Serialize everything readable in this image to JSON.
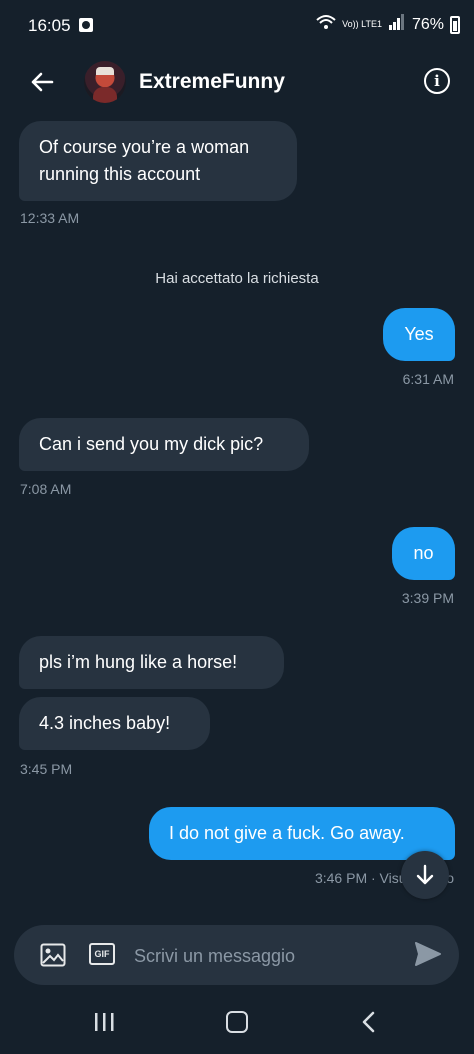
{
  "status_bar": {
    "time": "16:05",
    "network_label": "Vo)) LTE1",
    "battery": "76%"
  },
  "header": {
    "title": "ExtremeFunny"
  },
  "messages": [
    {
      "text": "Of course you’re a woman running this account",
      "time": "12:33 AM"
    },
    {
      "system_note": "Hai accettato la richiesta"
    },
    {
      "text": "Yes",
      "time": "6:31 AM"
    },
    {
      "text": "Can i send you my dick pic?",
      "time": "7:08 AM"
    },
    {
      "text": "no",
      "time": "3:39 PM"
    },
    {
      "text": "pls i’m hung like a horse!"
    },
    {
      "text": "4.3 inches baby!",
      "time": "3:45 PM"
    },
    {
      "text": "I do not give a fuck. Go away.",
      "time": "3:46 PM · Visualizzato"
    }
  ],
  "composer": {
    "placeholder": "Scrivi un messaggio",
    "gif_label": "GIF"
  },
  "icons": [
    "back-arrow-icon",
    "info-icon",
    "image-icon",
    "gif-icon",
    "send-icon",
    "arrow-down-icon",
    "recent-apps-icon",
    "home-icon",
    "nav-back-icon"
  ],
  "colors": {
    "background": "#15202b",
    "incoming_bubble": "#273340",
    "outgoing_bubble": "#1d9bf0",
    "timestamp": "#8b98a5"
  }
}
